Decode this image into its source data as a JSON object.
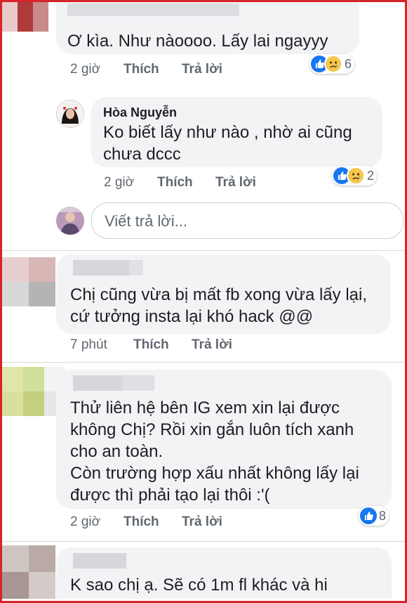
{
  "comments": [
    {
      "author": "",
      "text": "Ơ kìa. Như nàoooo. Lấy lai ngayyy",
      "time": "2 giờ",
      "like_label": "Thích",
      "reply_label": "Trả lời",
      "reaction_count": "6"
    },
    {
      "author": "Hòa Nguyễn",
      "text": "Ko biết lấy như nào , nhờ ai cũng\nchưa dccc",
      "time": "2 giờ",
      "like_label": "Thích",
      "reply_label": "Trả lời",
      "reaction_count": "2"
    },
    {
      "author": "",
      "text": "Chị cũng vừa bị mất fb xong vừa lấy lại,\ncứ tưởng insta lại khó hack @@",
      "time": "7 phút",
      "like_label": "Thích",
      "reply_label": "Trả lời"
    },
    {
      "author": "",
      "text": "Thử liên hệ bên IG xem xin lại được\nkhông Chị? Rồi xin gắn luôn tích xanh\ncho an toàn.\nCòn trường hợp xấu nhất không lấy lại\nđược thì phải tạo lại thôi :'(",
      "time": "2 giờ",
      "like_label": "Thích",
      "reply_label": "Trả lời",
      "reaction_count": "8"
    },
    {
      "author": "",
      "text": "K sao chị ạ.  Sẽ có 1m fl khác và hi"
    }
  ],
  "reply_box": {
    "placeholder": "Viết trả lời..."
  },
  "icons": [
    "like-icon",
    "sad-icon"
  ],
  "colors": {
    "frame": "#d6242b",
    "bubble": "#f2f3f5",
    "like": "#1877f2",
    "secondary_text": "#606770"
  }
}
